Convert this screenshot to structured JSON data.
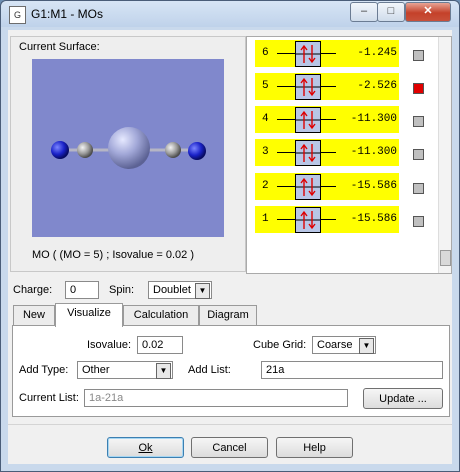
{
  "window": {
    "title": "G1:M1 - MOs",
    "app_icon": "gaussview-document-icon",
    "minimize": "–",
    "maximize": "□",
    "close": "✕"
  },
  "surface": {
    "label": "Current Surface:",
    "caption": "MO ( (MO = 5) ; Isovalue = 0.02 )"
  },
  "orbitals": [
    {
      "num": "6",
      "energy": "-1.245",
      "selected": false
    },
    {
      "num": "5",
      "energy": "-2.526",
      "selected": true
    },
    {
      "num": "4",
      "energy": "-11.300",
      "selected": false
    },
    {
      "num": "3",
      "energy": "-11.300",
      "selected": false
    },
    {
      "num": "2",
      "energy": "-15.586",
      "selected": false
    },
    {
      "num": "1",
      "energy": "-15.586",
      "selected": false
    }
  ],
  "charge": {
    "label": "Charge:",
    "value": "0"
  },
  "spin": {
    "label": "Spin:",
    "value": "Doublet"
  },
  "tabs": [
    "New",
    "Visualize",
    "Calculation",
    "Diagram"
  ],
  "active_tab": "Visualize",
  "visualize": {
    "isovalue_label": "Isovalue:",
    "isovalue": "0.02",
    "cube_grid_label": "Cube Grid:",
    "cube_grid": "Coarse",
    "add_type_label": "Add Type:",
    "add_type": "Other",
    "add_list_label": "Add List:",
    "add_list": "21a",
    "current_list_label": "Current List:",
    "current_list": "1a-21a",
    "update_label": "Update ..."
  },
  "buttons": {
    "ok": "Ok",
    "cancel": "Cancel",
    "help": "Help"
  },
  "colors": {
    "occupied_row": "#ffff00",
    "selected_check": "#e00000",
    "canvas_bg": "#8088cc"
  },
  "icons": {
    "electron_pair": "up-down-arrows-icon",
    "combo_arrow": "chevron-down-icon"
  }
}
